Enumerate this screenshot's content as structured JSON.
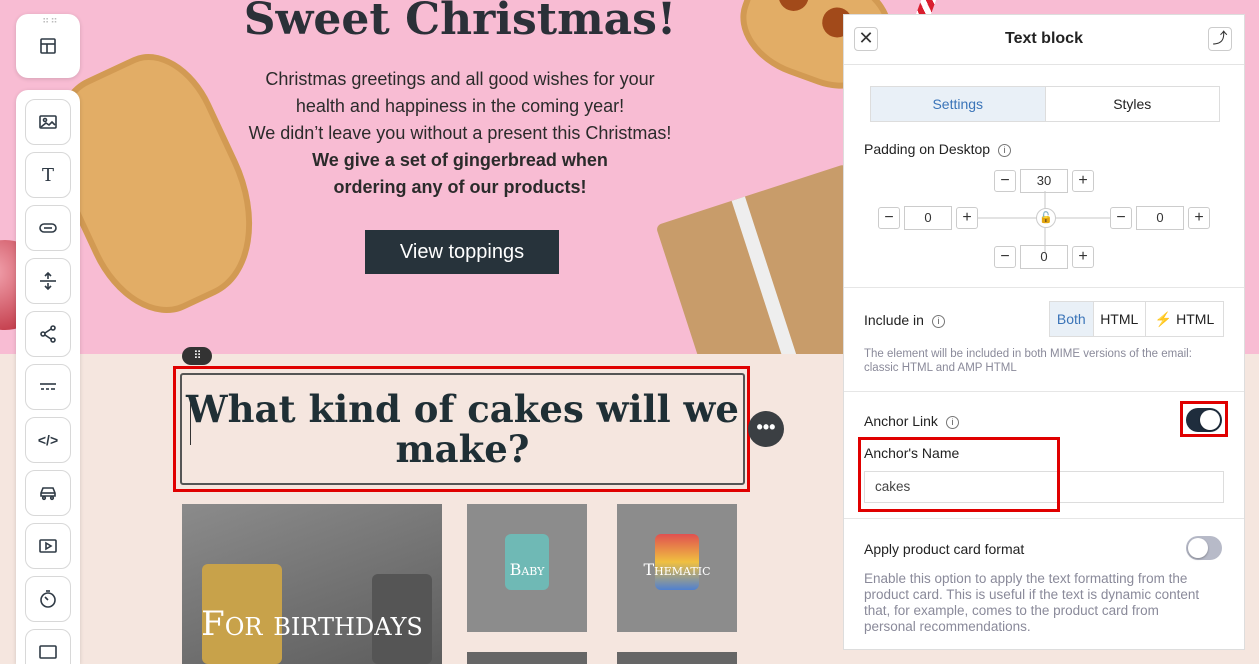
{
  "email": {
    "hero": {
      "title": "Sweet Christmas!",
      "lines": [
        "Christmas greetings and all good wishes for your",
        "health and happiness in the coming year!",
        "We didn’t leave you without a present this Christmas!"
      ],
      "bold_lines": [
        "We give a set of gingerbread when",
        "ordering any of our products!"
      ],
      "cta_label": "View toppings"
    },
    "section2": {
      "heading": "What kind of cakes will we make?",
      "tiles": [
        "For birthdays",
        "Baby",
        "Thematic"
      ]
    },
    "drag_handle_glyph": "⠿",
    "more_glyph": "•••"
  },
  "toolbar": {
    "top_icon": "layout-icon",
    "items": [
      "image-icon",
      "text-icon",
      "button-icon",
      "spacer-icon",
      "social-icon",
      "menu-icon",
      "html-icon",
      "car-icon",
      "video-icon",
      "timer-icon",
      "more-block-icon"
    ]
  },
  "panel": {
    "title": "Text block",
    "close_glyph": "✕",
    "expand_glyph": "⤴",
    "tabs": {
      "settings": "Settings",
      "styles": "Styles"
    },
    "padding": {
      "label": "Padding on Desktop",
      "top": "30",
      "left": "0",
      "right": "0",
      "bottom": "0",
      "minus": "−",
      "plus": "+"
    },
    "include_in": {
      "label": "Include in",
      "options": {
        "both": "Both",
        "html": "HTML",
        "amp": "HTML"
      },
      "hint_line1": "The element will be included in both MIME versions of the email:",
      "hint_line2": "classic HTML and AMP HTML"
    },
    "anchor": {
      "label": "Anchor Link",
      "enabled": true,
      "name_label": "Anchor's Name",
      "name_value": "cakes"
    },
    "product_card": {
      "label": "Apply product card format",
      "enabled": false,
      "hint_lines": [
        "Enable this option to apply the text formatting from the",
        "product card. This is useful if the text is dynamic content",
        "that, for example, comes to the product card from",
        "personal recommendations."
      ]
    },
    "info_glyph": "i",
    "lock_glyph": "🔓"
  },
  "colors": {
    "hero_bg": "#f8bcd3",
    "cta_bg": "#27333b",
    "highlight": "#e00000",
    "accent_blue": "#3a74b8",
    "toggle_on": "#1f2d3d"
  }
}
